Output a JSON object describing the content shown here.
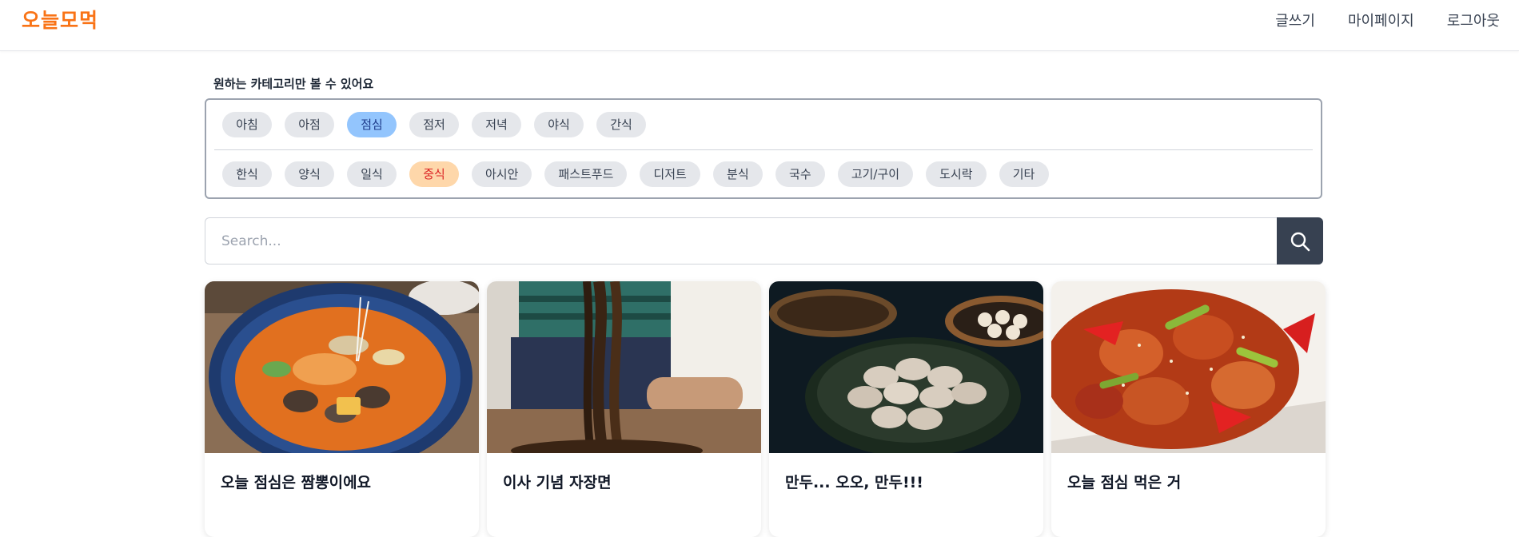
{
  "header": {
    "brand": "오늘모먹",
    "nav": [
      "글쓰기",
      "마이페이지",
      "로그아웃"
    ]
  },
  "filter": {
    "title": "원하는 카테고리만 볼 수 있어요",
    "time_chips": [
      "아침",
      "아점",
      "점심",
      "점저",
      "저녁",
      "야식",
      "간식"
    ],
    "selected_time": "점심",
    "cuisine_chips": [
      "한식",
      "양식",
      "일식",
      "중식",
      "아시안",
      "패스트푸드",
      "디저트",
      "분식",
      "국수",
      "고기/구이",
      "도시락",
      "기타"
    ],
    "selected_cuisine": "중식"
  },
  "search": {
    "placeholder": "Search..."
  },
  "cards": [
    {
      "title": "오늘 점심은 짬뽕이에요",
      "image": "jjamppong-photo"
    },
    {
      "title": "이사 기념 자장면",
      "image": "jajangmyeon-photo"
    },
    {
      "title": "만두... 오오, 만두!!!",
      "image": "dumplings-photo"
    },
    {
      "title": "오늘 점심 먹은 거",
      "image": "sweet-sour-pork-photo"
    }
  ],
  "colors": {
    "brand": "#f97316",
    "selected_time_bg": "#93c5fd",
    "selected_cuisine_bg": "#fed7aa",
    "search_button": "#374151"
  },
  "icons": {
    "search_button": "search-icon"
  }
}
